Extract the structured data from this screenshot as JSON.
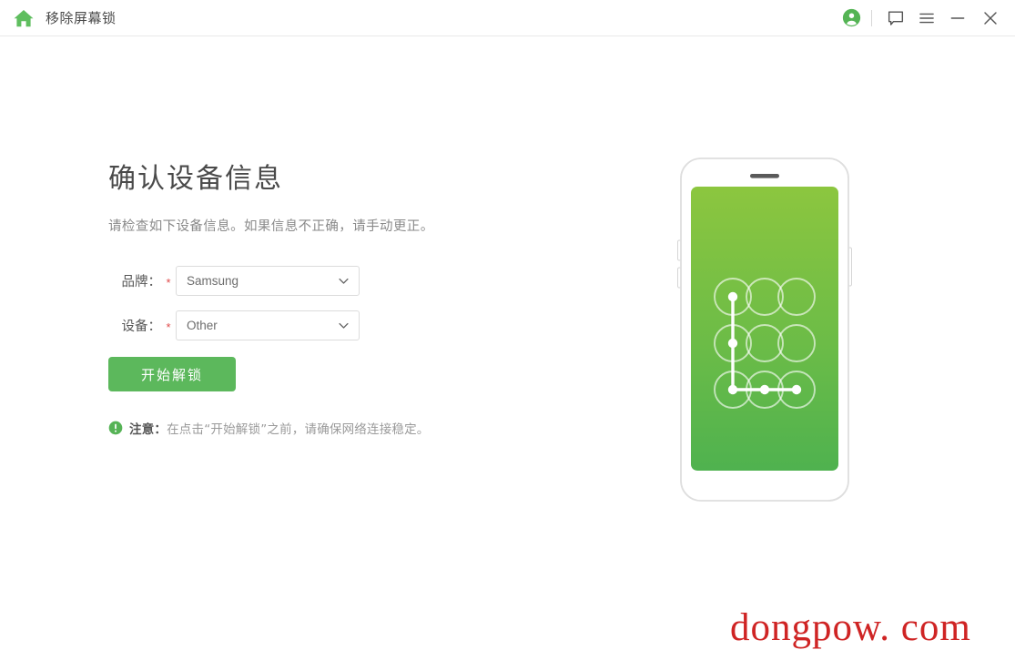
{
  "window": {
    "title": "移除屏幕锁",
    "home_icon": "home-icon",
    "account_icon": "account-circle-icon",
    "feedback_icon": "chat-bubble-icon",
    "menu_icon": "hamburger-menu-icon",
    "minimize_icon": "minimize-icon",
    "close_icon": "close-icon"
  },
  "main": {
    "title": "确认设备信息",
    "subtitle": "请检查如下设备信息。如果信息不正确，请手动更正。",
    "fields": [
      {
        "label": "品牌：",
        "required_mark": "*",
        "value": "Samsung",
        "chevron_icon": "chevron-down-icon"
      },
      {
        "label": "设备：",
        "required_mark": "*",
        "value": "Other",
        "chevron_icon": "chevron-down-icon"
      }
    ],
    "start_button": "开始解锁",
    "note": {
      "icon": "exclamation-circle-icon",
      "prefix": "注意：",
      "text": "在点击“开始解锁”之前，请确保网络连接稳定。"
    }
  },
  "illustration": {
    "name": "phone-pattern-lock",
    "screen_gradient_top": "#8CC63F",
    "screen_gradient_bottom": "#4FB24F",
    "pattern_dots_filled": [
      1,
      4,
      7,
      8,
      9
    ],
    "pattern_path": "1-4-7-8-9"
  },
  "watermark": {
    "text": "dongpow. com",
    "color": "#cf2424"
  },
  "colors": {
    "accent_green": "#5cb85c",
    "required_red": "#e04b4b",
    "title_gray": "#4a4a4a",
    "subtitle_gray": "#8a8a8a"
  }
}
